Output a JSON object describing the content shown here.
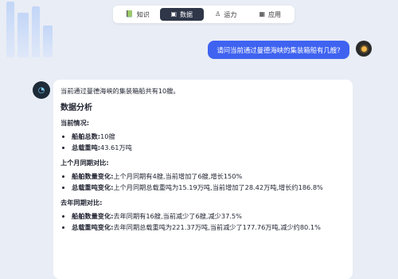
{
  "tabs": [
    {
      "icon": "📗",
      "label": "知识"
    },
    {
      "icon": "▣",
      "label": "数据"
    },
    {
      "icon": "♙",
      "label": "运力"
    },
    {
      "icon": "▦",
      "label": "应用"
    }
  ],
  "active_tab": 1,
  "user_message": "请问当前通过曼德海峡的集装箱船有几艘?",
  "answer": {
    "summary": "当前通过曼德海峡的集装箱船共有10艘。",
    "section_title": "数据分析",
    "current": {
      "title": "当前情况:",
      "items": [
        {
          "key": "船舶总数:",
          "value": "10艘"
        },
        {
          "key": "总载重吨:",
          "value": "43.61万吨"
        }
      ]
    },
    "last_month": {
      "title": "上个月同期对比:",
      "items": [
        {
          "key": "船舶数量变化:",
          "value": "上个月同期有4艘,当前增加了6艘,增长150%"
        },
        {
          "key": "总载重吨变化:",
          "value": "上个月同期总载重吨为15.19万吨,当前增加了28.42万吨,增长约186.8%"
        }
      ]
    },
    "last_year": {
      "title": "去年同期对比:",
      "items": [
        {
          "key": "船舶数量变化:",
          "value": "去年同期有16艘,当前减少了6艘,减少37.5%"
        },
        {
          "key": "总载重吨变化:",
          "value": "去年同期总载重吨为221.37万吨,当前减少了177.76万吨,减少约80.1%"
        }
      ]
    }
  }
}
